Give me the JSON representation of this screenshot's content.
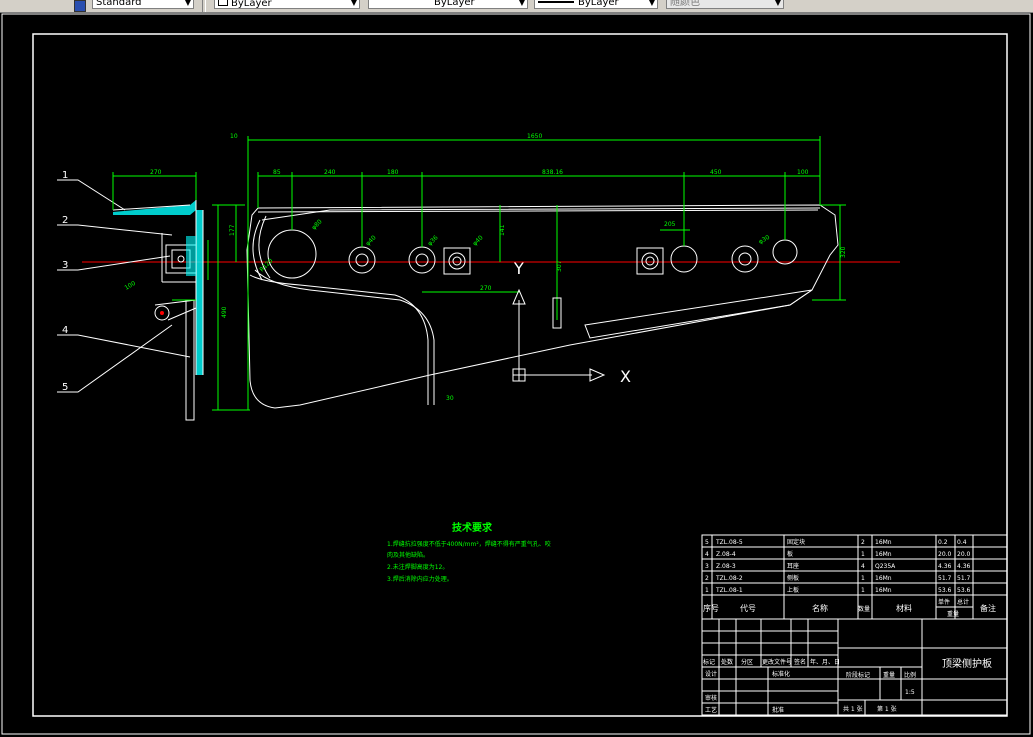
{
  "toolbar": {
    "text_style": "Standard",
    "color_control": "ByLayer",
    "linetype_control": "ByLayer",
    "lineweight_control": "ByLayer",
    "plot_style": "随颜色"
  },
  "colors": {
    "background": "#000000",
    "frame": "#ffffff",
    "dimension": "#00ff00",
    "center_line": "#ff0000",
    "hatch": "#00ffff",
    "notes": "#00ff00",
    "title_text": "#ffff00"
  },
  "drawing": {
    "leaders": [
      "1",
      "2",
      "3",
      "4",
      "5"
    ],
    "dims_top": {
      "overall": "1650",
      "d10": "10",
      "d85": "85",
      "d240": "240",
      "d180": "180",
      "d838": "838.16",
      "d450": "450",
      "d100": "100",
      "d270": "270",
      "d205": "205"
    },
    "dims_side": {
      "d177": "177",
      "d141": "141",
      "d490": "490",
      "d307": "307",
      "d30": "30",
      "d320": "320"
    },
    "hole_labels": [
      "R120",
      "φ40",
      "φ36",
      "φ40",
      "φ30",
      "φ80",
      "100"
    ],
    "ucs": {
      "y_label": "Y",
      "x_label": "X"
    }
  },
  "notes": {
    "title": "技术要求",
    "lines": [
      "1.焊缝抗拉强度不低于400N/mm²，焊缝不得有严重气孔、咬",
      "肉及其他缺陷。",
      "2.未注焊脚高度为12。",
      "3.焊后消除内应力处理。"
    ]
  },
  "bom": {
    "rows": [
      {
        "no": "5",
        "code": "TZL.08-5",
        "name": "固定块",
        "qty": "2",
        "material": "16Mn",
        "unit": "0.2",
        "total": "0.4"
      },
      {
        "no": "4",
        "code": "Z.08-4",
        "name": "板",
        "qty": "1",
        "material": "16Mn",
        "unit": "20.0",
        "total": "20.0"
      },
      {
        "no": "3",
        "code": "Z.08-3",
        "name": "耳座",
        "qty": "4",
        "material": "Q235A",
        "unit": "4.36",
        "total": "4.36"
      },
      {
        "no": "2",
        "code": "TZL.08-2",
        "name": "侧板",
        "qty": "1",
        "material": "16Mn",
        "unit": "51.7",
        "total": "51.7"
      },
      {
        "no": "1",
        "code": "TZL.08-1",
        "name": "上板",
        "qty": "1",
        "material": "16Mn",
        "unit": "53.6",
        "total": "53.6"
      }
    ],
    "headers": {
      "no": "序号",
      "code": "代号",
      "name": "名称",
      "qty": "数量",
      "material": "材料",
      "unit": "单件",
      "total": "总计",
      "weight": "重量",
      "remark": "备注"
    }
  },
  "title_block": {
    "part_name": "顶梁侧护板",
    "scale": "1:5",
    "labels": {
      "mark": "标记",
      "count": "处数",
      "zone": "分区",
      "change_doc": "更改文件号",
      "sign": "签名",
      "date": "年、月、日",
      "designer": "设计",
      "standard": "标准化",
      "check": "审核",
      "process": "工艺",
      "approve": "批准",
      "stage_mark": "阶段标记",
      "weight": "重量",
      "ratio": "比例",
      "sheets": "共 1 张",
      "sheet_no": "第 1 张"
    }
  }
}
